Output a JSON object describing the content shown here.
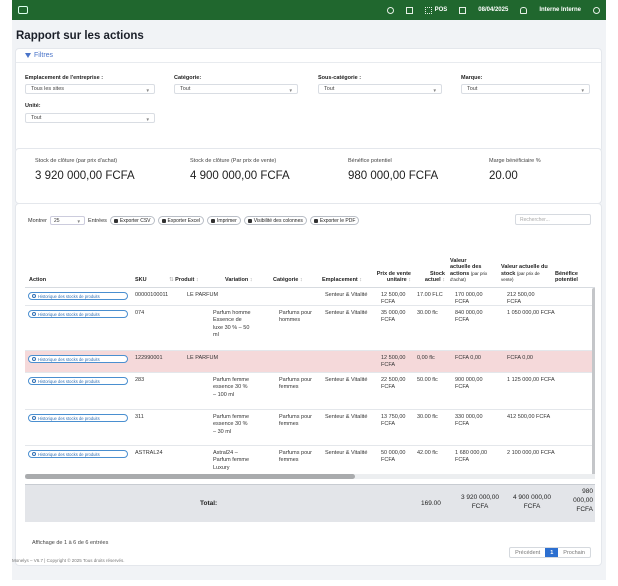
{
  "topbar": {
    "pos_label": "POS",
    "date": "08/04/2025",
    "user": "Interne Interne"
  },
  "page_title": "Rapport sur les actions",
  "filters": {
    "title": "Filtres",
    "location_label": "Emplacement de l'entreprise :",
    "location_value": "Tous les sites",
    "category_label": "Catégorie:",
    "category_value": "Tout",
    "subcategory_label": "Sous-catégorie :",
    "subcategory_value": "Tout",
    "brand_label": "Marque:",
    "brand_value": "Tout",
    "unit_label": "Unité:",
    "unit_value": "Tout"
  },
  "stats": [
    {
      "label": "Stock de clôture (par prix d'achat)",
      "value": "3 920 000,00 FCFA"
    },
    {
      "label": "Stock de clôture (Par prix de vente)",
      "value": "4 900 000,00 FCFA"
    },
    {
      "label": "Bénéfice potentiel",
      "value": "980 000,00 FCFA"
    },
    {
      "label": "Marge bénéficiaire %",
      "value": "20.00"
    }
  ],
  "toolbar": {
    "show_label": "Montrer",
    "show_value": "25",
    "entries_label": "Entrées",
    "export_csv": "Exporter CSV",
    "export_excel": "Exporter Excel",
    "print": "Imprimer",
    "columns": "Visibilité des colonnes",
    "export_pdf": "Exporter le PDF",
    "search_placeholder": "Rechercher..."
  },
  "table": {
    "headers": {
      "action": "Action",
      "sku": "SKU",
      "product": "Produit",
      "variation": "Variation",
      "category": "Catégorie",
      "location": "Emplacement",
      "unit_price": "Prix de vente unitaire",
      "stock": "Stock actuel",
      "stock_value_purchase": "Valeur actuelle des actions",
      "stock_value_purchase_sub": "(par prix d'achat)",
      "stock_value_sale": "Valeur actuelle du stock",
      "stock_value_sale_sub": "(par prix de vente)",
      "profit": "Bénéfice potentiel"
    },
    "history_label": "Historique des stocks de produits",
    "rows": [
      {
        "sku": "00000100011",
        "product": "LE PARFUM",
        "variation": "",
        "category": "",
        "location": "Senteur & Vitalité",
        "price": "12 500,00 FCFA",
        "stock": "17.00 FLC",
        "val_purchase": "170 000,00 FCFA",
        "val_sale": "212 500,00 FCFA",
        "profit": ""
      },
      {
        "sku": "074",
        "product": "",
        "variation": "Parfum homme Essence de luxe 30 % – 50 ml",
        "category": "Parfums pour hommes",
        "location": "Senteur & Vitalité",
        "price": "35 000,00 FCFA",
        "stock": "30.00 flc",
        "val_purchase": "840 000,00 FCFA",
        "val_sale": "1 050 000,00 FCFA",
        "profit": ""
      },
      {
        "sku": "122990001",
        "product": "LE PARFUM",
        "variation": "",
        "category": "",
        "location": "",
        "price": "12 500,00 FCFA",
        "stock": "0,00 flc",
        "val_purchase": "FCFA 0,00",
        "val_sale": "FCFA 0,00",
        "profit": ""
      },
      {
        "sku": "283",
        "product": "",
        "variation": "Parfum femme essence 30 % – 100 ml",
        "category": "Parfums pour femmes",
        "location": "Senteur & Vitalité",
        "price": "22 500,00 FCFA",
        "stock": "50.00 flc",
        "val_purchase": "900 000,00 FCFA",
        "val_sale": "1 125 000,00 FCFA",
        "profit": ""
      },
      {
        "sku": "311",
        "product": "",
        "variation": "Parfum femme essence 30 % – 30 ml",
        "category": "Parfums pour femmes",
        "location": "Senteur & Vitalité",
        "price": "13 750,00 FCFA",
        "stock": "30.00 flc",
        "val_purchase": "330 000,00 FCFA",
        "val_sale": "412 500,00 FCFA",
        "profit": ""
      },
      {
        "sku": "ASTRAL24",
        "product": "",
        "variation": "Astral24 – Parfum femme Luxury",
        "category": "Parfums pour femmes",
        "location": "Senteur & Vitalité",
        "price": "50 000,00 FCFA",
        "stock": "42.00 flc",
        "val_purchase": "1 680 000,00 FCFA",
        "val_sale": "2 100 000,00 FCFA",
        "profit": ""
      }
    ],
    "total": {
      "label": "Total:",
      "stock": "169.00",
      "val_purchase": "3 920 000,00 FCFA",
      "val_sale": "4 900 000,00 FCFA",
      "profit": "980 000,00 FCFA"
    }
  },
  "showing": "Affichage de 1 à 6 de 6 entrées",
  "pagination": {
    "prev": "Précédent",
    "current": "1",
    "next": "Prochain"
  },
  "footer": "Monelys – V6.7 | Copyright © 2025 Tous droits réservés."
}
